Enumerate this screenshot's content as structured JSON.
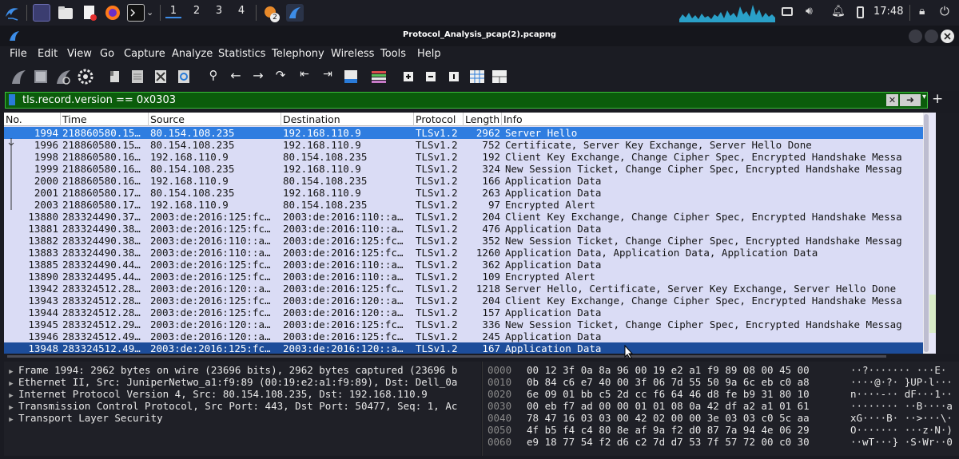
{
  "taskbar": {
    "workspaces": [
      "1",
      "2",
      "3",
      "4"
    ],
    "notification_count": "2",
    "clock": "17:48",
    "icons": [
      "kali-menu-icon",
      "workspace-switcher-icon",
      "file-manager-icon",
      "text-editor-icon",
      "firefox-icon",
      "terminal-icon",
      "chevron-down-icon",
      "burp-icon",
      "wireshark-taskbar-icon",
      "display-icon",
      "volume-icon",
      "bell-icon",
      "battery-icon",
      "lock-icon",
      "power-icon"
    ]
  },
  "window": {
    "title": "Protocol_Analysis_pcap(2).pcapng"
  },
  "menu": [
    "File",
    "Edit",
    "View",
    "Go",
    "Capture",
    "Analyze",
    "Statistics",
    "Telephony",
    "Wireless",
    "Tools",
    "Help"
  ],
  "filter": {
    "value": "tls.record.version == 0x0303"
  },
  "columns": [
    "No.",
    "Time",
    "Source",
    "Destination",
    "Protocol",
    "Length",
    "Info"
  ],
  "packets": [
    {
      "no": "1994",
      "time": "218860580.15…",
      "src": "80.154.108.235",
      "dst": "192.168.110.9",
      "proto": "TLSv1.2",
      "len": "2962",
      "info": "Server Hello"
    },
    {
      "no": "1996",
      "time": "218860580.15…",
      "src": "80.154.108.235",
      "dst": "192.168.110.9",
      "proto": "TLSv1.2",
      "len": "752",
      "info": "Certificate, Server Key Exchange, Server Hello Done"
    },
    {
      "no": "1998",
      "time": "218860580.16…",
      "src": "192.168.110.9",
      "dst": "80.154.108.235",
      "proto": "TLSv1.2",
      "len": "192",
      "info": "Client Key Exchange, Change Cipher Spec, Encrypted Handshake Messa"
    },
    {
      "no": "1999",
      "time": "218860580.16…",
      "src": "80.154.108.235",
      "dst": "192.168.110.9",
      "proto": "TLSv1.2",
      "len": "324",
      "info": "New Session Ticket, Change Cipher Spec, Encrypted Handshake Messag"
    },
    {
      "no": "2000",
      "time": "218860580.16…",
      "src": "192.168.110.9",
      "dst": "80.154.108.235",
      "proto": "TLSv1.2",
      "len": "166",
      "info": "Application Data"
    },
    {
      "no": "2001",
      "time": "218860580.17…",
      "src": "80.154.108.235",
      "dst": "192.168.110.9",
      "proto": "TLSv1.2",
      "len": "263",
      "info": "Application Data"
    },
    {
      "no": "2003",
      "time": "218860580.17…",
      "src": "192.168.110.9",
      "dst": "80.154.108.235",
      "proto": "TLSv1.2",
      "len": "97",
      "info": "Encrypted Alert"
    },
    {
      "no": "13880",
      "time": "283324490.37…",
      "src": "2003:de:2016:125:fc…",
      "dst": "2003:de:2016:110::a…",
      "proto": "TLSv1.2",
      "len": "204",
      "info": "Client Key Exchange, Change Cipher Spec, Encrypted Handshake Messa"
    },
    {
      "no": "13881",
      "time": "283324490.38…",
      "src": "2003:de:2016:125:fc…",
      "dst": "2003:de:2016:110::a…",
      "proto": "TLSv1.2",
      "len": "476",
      "info": "Application Data"
    },
    {
      "no": "13882",
      "time": "283324490.38…",
      "src": "2003:de:2016:110::a…",
      "dst": "2003:de:2016:125:fc…",
      "proto": "TLSv1.2",
      "len": "352",
      "info": "New Session Ticket, Change Cipher Spec, Encrypted Handshake Messag"
    },
    {
      "no": "13883",
      "time": "283324490.38…",
      "src": "2003:de:2016:110::a…",
      "dst": "2003:de:2016:125:fc…",
      "proto": "TLSv1.2",
      "len": "1260",
      "info": "Application Data, Application Data, Application Data"
    },
    {
      "no": "13885",
      "time": "283324490.44…",
      "src": "2003:de:2016:125:fc…",
      "dst": "2003:de:2016:110::a…",
      "proto": "TLSv1.2",
      "len": "362",
      "info": "Application Data"
    },
    {
      "no": "13890",
      "time": "283324495.44…",
      "src": "2003:de:2016:125:fc…",
      "dst": "2003:de:2016:110::a…",
      "proto": "TLSv1.2",
      "len": "109",
      "info": "Encrypted Alert"
    },
    {
      "no": "13942",
      "time": "283324512.28…",
      "src": "2003:de:2016:120::a…",
      "dst": "2003:de:2016:125:fc…",
      "proto": "TLSv1.2",
      "len": "1218",
      "info": "Server Hello, Certificate, Server Key Exchange, Server Hello Done"
    },
    {
      "no": "13943",
      "time": "283324512.28…",
      "src": "2003:de:2016:125:fc…",
      "dst": "2003:de:2016:120::a…",
      "proto": "TLSv1.2",
      "len": "204",
      "info": "Client Key Exchange, Change Cipher Spec, Encrypted Handshake Messa"
    },
    {
      "no": "13944",
      "time": "283324512.28…",
      "src": "2003:de:2016:125:fc…",
      "dst": "2003:de:2016:120::a…",
      "proto": "TLSv1.2",
      "len": "157",
      "info": "Application Data"
    },
    {
      "no": "13945",
      "time": "283324512.29…",
      "src": "2003:de:2016:120::a…",
      "dst": "2003:de:2016:125:fc…",
      "proto": "TLSv1.2",
      "len": "336",
      "info": "New Session Ticket, Change Cipher Spec, Encrypted Handshake Messag"
    },
    {
      "no": "13946",
      "time": "283324512.49…",
      "src": "2003:de:2016:120::a…",
      "dst": "2003:de:2016:125:fc…",
      "proto": "TLSv1.2",
      "len": "245",
      "info": "Application Data"
    },
    {
      "no": "13948",
      "time": "283324512.49…",
      "src": "2003:de:2016:125:fc…",
      "dst": "2003:de:2016:120::a…",
      "proto": "TLSv1.2",
      "len": "167",
      "info": "Application Data"
    }
  ],
  "details": [
    "Frame 1994: 2962 bytes on wire (23696 bits), 2962 bytes captured (23696 b",
    "Ethernet II, Src: JuniperNetwo_a1:f9:89 (00:19:e2:a1:f9:89), Dst: Dell_0a",
    "Internet Protocol Version 4, Src: 80.154.108.235, Dst: 192.168.110.9",
    "Transmission Control Protocol, Src Port: 443, Dst Port: 50477, Seq: 1, Ac",
    "Transport Layer Security"
  ],
  "bytes": [
    {
      "off": "0000",
      "hex": "00 12 3f 0a 8a 96 00 19  e2 a1 f9 89 08 00 45 00",
      "ascii": "··?·······  ···E·"
    },
    {
      "off": "0010",
      "hex": "0b 84 c6 e7 40 00 3f 06  7d 55 50 9a 6c eb c0 a8",
      "ascii": "····@·?· }UP·l···"
    },
    {
      "off": "0020",
      "hex": "6e 09 01 bb c5 2d cc f6  64 46 d8 fe b9 31 80 10",
      "ascii": "n····-·· dF···1··"
    },
    {
      "off": "0030",
      "hex": "00 eb f7 ad 00 00 01 01  08 0a 42 df a2 a1 01 61",
      "ascii": "········ ··B····a"
    },
    {
      "off": "0040",
      "hex": "78 47 16 03 03 00 42 02  00 00 3e 03 03 c0 5c aa",
      "ascii": "xG····B· ··>···\\·"
    },
    {
      "off": "0050",
      "hex": "4f b5 f4 c4 80 8e af 9a  f2 d0 87 7a 94 4e 06 29",
      "ascii": "O······· ···z·N·)"
    },
    {
      "off": "0060",
      "hex": "e9 18 77 54 f2 d6 c2 7d  d7 53 7f 57 72 00 c0 30",
      "ascii": "··wT···} ·S·Wr··0"
    }
  ],
  "colors": {
    "list_bg": "#dadcf5",
    "selected": "#2f7de0",
    "filter_ok": "#0b5c0b"
  }
}
